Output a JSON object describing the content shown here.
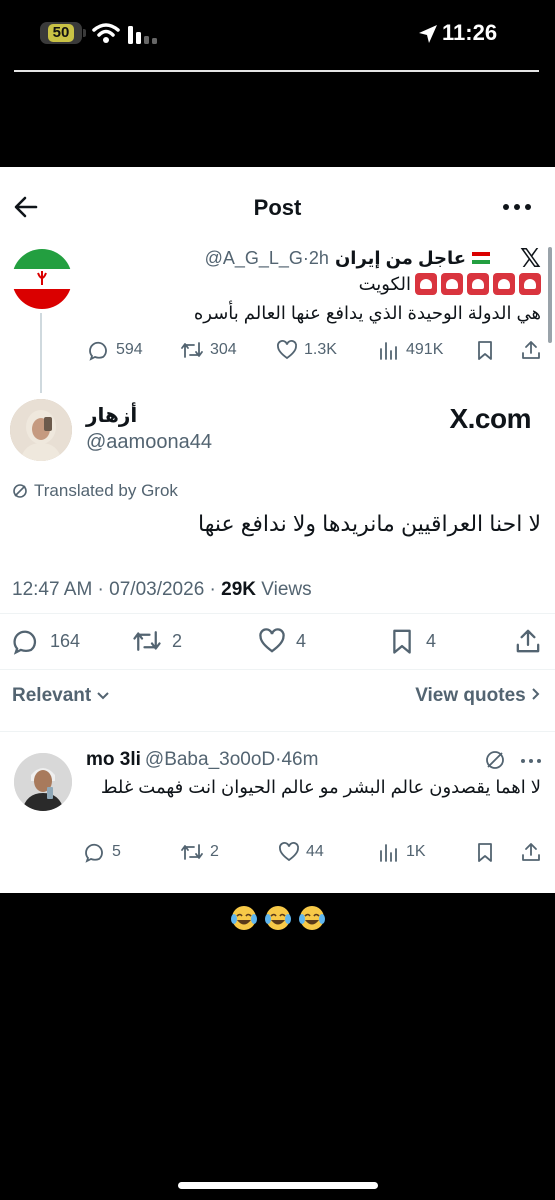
{
  "status_bar": {
    "battery": "50",
    "time": "11:26"
  },
  "header": {
    "title": "Post"
  },
  "quoted_tweet": {
    "name": "عاجل من إيران",
    "handle": "@A_G_L_G",
    "time": "2h",
    "line1": "الكويت",
    "line2": "هي الدولة الوحيدة الذي يدافع عنها العالم بأسره",
    "replies": "594",
    "reposts": "304",
    "likes": "1.3K",
    "views": "491K"
  },
  "main_tweet": {
    "name": "أزهار",
    "handle": "@aamoona44",
    "brand": "X.com",
    "translated_label": "Translated by Grok",
    "text": "لا احنا العراقيين مانريدها ولا ندافع عنها",
    "timestamp": "12:47 AM · 07/03/2026 · ",
    "views_count": "29K",
    "views_label": " Views",
    "replies": "164",
    "reposts": "2",
    "likes": "4",
    "bookmarks": "4"
  },
  "sort": {
    "relevant": "Relevant",
    "view_quotes": "View quotes"
  },
  "reply": {
    "name": "mo 3li",
    "handle": "@Baba_3o0oD",
    "time": "46m",
    "text": "لا اهما يقصدون عالم البشر مو عالم الحيوان انت فهمت غلط",
    "replies": "5",
    "reposts": "2",
    "likes": "44",
    "views": "1K"
  },
  "caption": {
    "emojis": "😂😂😂"
  },
  "colors": {
    "text": "#0f1419",
    "secondary": "#536471",
    "siren": "#d9343e"
  }
}
